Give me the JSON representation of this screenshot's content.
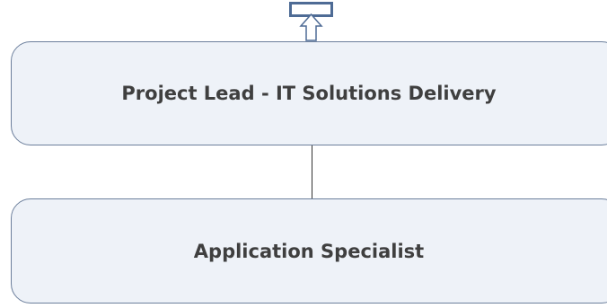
{
  "navigation": {
    "up_icon": "up-arrow-icon"
  },
  "nodes": {
    "parent": {
      "label": "Project Lead - IT Solutions Delivery"
    },
    "child": {
      "label": "Application Specialist"
    }
  },
  "colors": {
    "node_fill": "#eef2f8",
    "node_border": "#6c7f9c",
    "icon_stroke": "#4e6b95",
    "text": "#3f3f3f",
    "connector": "#333333"
  }
}
